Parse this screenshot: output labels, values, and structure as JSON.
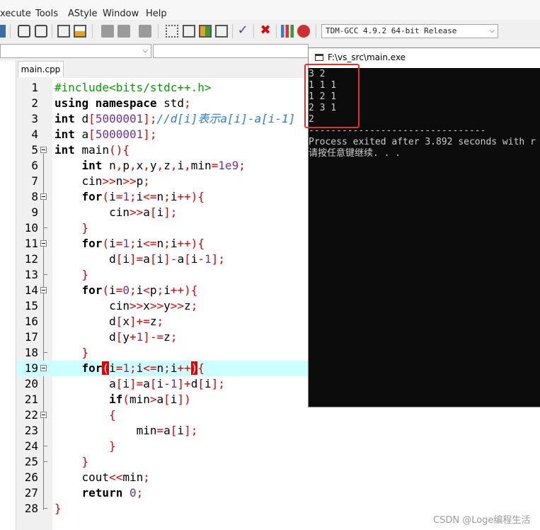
{
  "menu": {
    "items": [
      "xecute",
      "Tools",
      "AStyle",
      "Window",
      "Help"
    ]
  },
  "toolbar": {
    "compiler": "TDM-GCC 4.9.2 64-bit Release"
  },
  "editor": {
    "tab": "main.cpp",
    "lines": [
      {
        "n": "1",
        "code": "#include<bits/stdc++.h>"
      },
      {
        "n": "2",
        "code": "using namespace std;"
      },
      {
        "n": "3",
        "code": "int d[5000001];//d[i]表示a[i]-a[i-1]"
      },
      {
        "n": "4",
        "code": "int a[5000001];"
      },
      {
        "n": "5",
        "code": "int main(){"
      },
      {
        "n": "6",
        "code": "    int n,p,x,y,z,i,min=1e9;"
      },
      {
        "n": "7",
        "code": "    cin>>n>>p;"
      },
      {
        "n": "8",
        "code": "    for(i=1;i<=n;i++){"
      },
      {
        "n": "9",
        "code": "        cin>>a[i];"
      },
      {
        "n": "10",
        "code": "    }"
      },
      {
        "n": "11",
        "code": "    for(i=1;i<=n;i++){"
      },
      {
        "n": "12",
        "code": "        d[i]=a[i]-a[i-1];"
      },
      {
        "n": "13",
        "code": "    }"
      },
      {
        "n": "14",
        "code": "    for(i=0;i<p;i++){"
      },
      {
        "n": "15",
        "code": "        cin>>x>>y>>z;"
      },
      {
        "n": "16",
        "code": "        d[x]+=z;"
      },
      {
        "n": "17",
        "code": "        d[y+1]-=z;"
      },
      {
        "n": "18",
        "code": "    }"
      },
      {
        "n": "19",
        "code": "    for(i=1;i<=n;i++){"
      },
      {
        "n": "20",
        "code": "        a[i]=a[i-1]+d[i];"
      },
      {
        "n": "21",
        "code": "        if(min>a[i])"
      },
      {
        "n": "22",
        "code": "        {"
      },
      {
        "n": "23",
        "code": "            min=a[i];"
      },
      {
        "n": "24",
        "code": "        }"
      },
      {
        "n": "25",
        "code": "    }"
      },
      {
        "n": "26",
        "code": "    cout<<min;"
      },
      {
        "n": "27",
        "code": "    return 0;"
      },
      {
        "n": "28",
        "code": "}"
      }
    ]
  },
  "console": {
    "title": "F:\\vs_src\\main.exe",
    "lines": [
      "3 2",
      "1 1 1",
      "1 2 1",
      "2 3 1",
      "2",
      "--------------------------------",
      "Process exited after 3.892 seconds with r",
      "请按任意键继续. . ."
    ]
  },
  "watermark": "CSDN @Loge编程生活",
  "colors": {
    "keyword_red": "#e00000",
    "comment_blue": "#2b7be8",
    "include_green": "#00a000",
    "highlight": "#ccffff",
    "number_purple": "#7030a0"
  }
}
